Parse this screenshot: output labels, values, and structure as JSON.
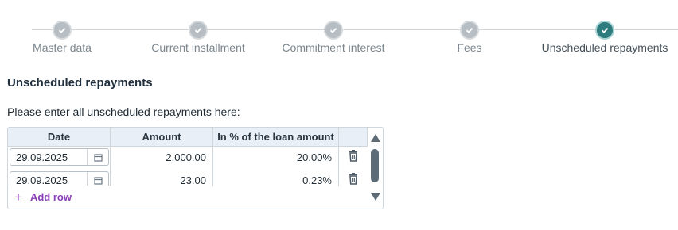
{
  "stepper": {
    "steps": [
      {
        "label": "Master data",
        "state": "done"
      },
      {
        "label": "Current installment",
        "state": "done"
      },
      {
        "label": "Commitment interest",
        "state": "done"
      },
      {
        "label": "Fees",
        "state": "done"
      },
      {
        "label": "Unscheduled repayments",
        "state": "active"
      }
    ],
    "icon": "check-icon"
  },
  "section": {
    "title": "Unscheduled repayments",
    "intro": "Please enter all unscheduled repayments here:"
  },
  "table": {
    "columns": [
      "Date",
      "Amount",
      "In % of the loan amount"
    ],
    "rows": [
      {
        "date": "29.09.2025",
        "amount": "2,000.00",
        "percent": "20.00%"
      },
      {
        "date": "29.09.2025",
        "amount": "23.00",
        "percent": "0.23%"
      }
    ],
    "add_row_label": "Add row"
  },
  "colors": {
    "accent": "#2e7c7e",
    "link": "#8a3fb8",
    "header_bg": "#e8eff6"
  }
}
